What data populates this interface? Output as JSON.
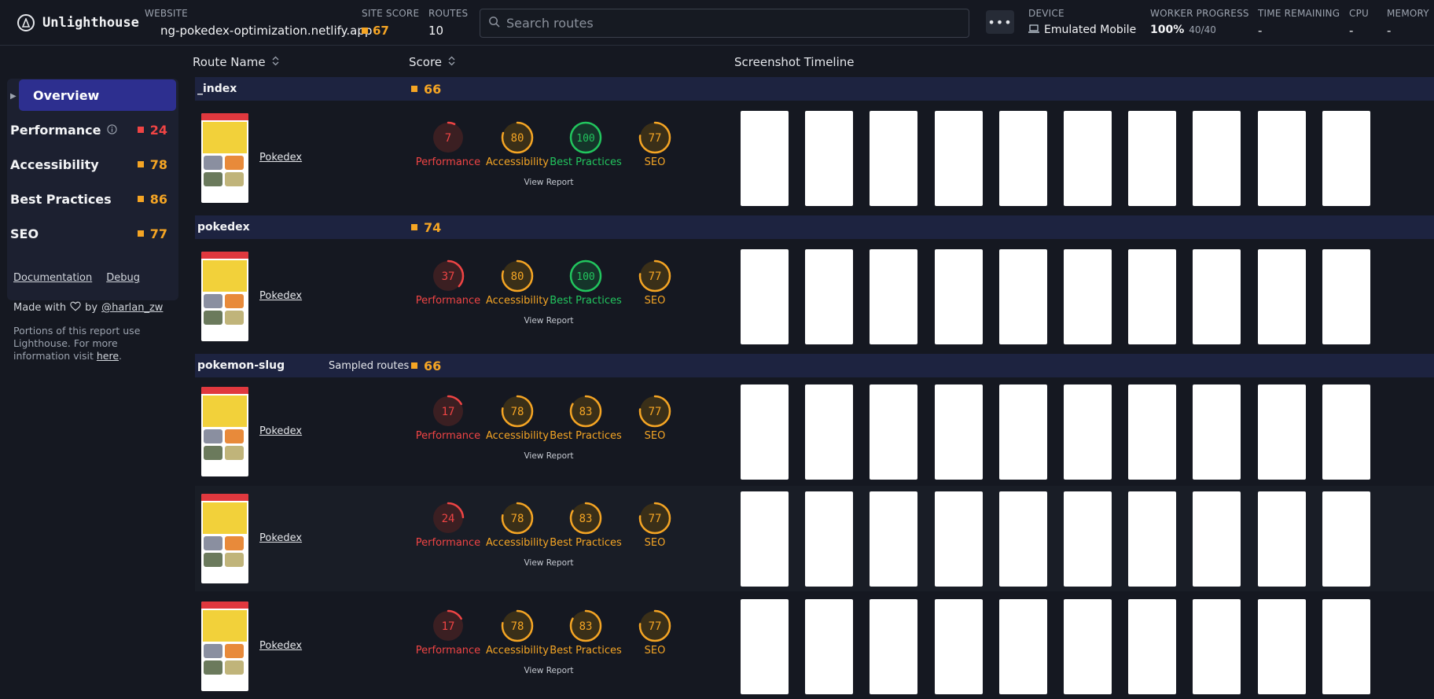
{
  "app": {
    "name": "Unlighthouse"
  },
  "header": {
    "website_label": "WEBSITE",
    "website_value": "ng-pokedex-optimization.netlify.app",
    "site_score_label": "SITE SCORE",
    "site_score_value": "67",
    "routes_label": "ROUTES",
    "routes_value": "10",
    "search_placeholder": "Search routes",
    "more_label": "•••",
    "device_label": "DEVICE",
    "device_value": "Emulated Mobile",
    "worker_label": "WORKER PROGRESS",
    "worker_value": "100%",
    "worker_count": "40/40",
    "time_label": "TIME REMAINING",
    "time_value": "-",
    "cpu_label": "CPU",
    "cpu_value": "-",
    "memory_label": "MEMORY",
    "memory_value": "-"
  },
  "sidebar": {
    "overview": "Overview",
    "items": [
      {
        "label": "Performance",
        "score": "24",
        "color": "#ef4444"
      },
      {
        "label": "Accessibility",
        "score": "78",
        "color": "#f5a524"
      },
      {
        "label": "Best Practices",
        "score": "86",
        "color": "#f5a524"
      },
      {
        "label": "SEO",
        "score": "77",
        "color": "#f5a524"
      }
    ],
    "documentation": "Documentation",
    "debug": "Debug",
    "made_with": "Made with",
    "by": "by",
    "author": "@harlan_zw",
    "portions": "Portions of this report use Lighthouse. For more information visit",
    "here": "here",
    "period": "."
  },
  "table": {
    "col_route": "Route Name",
    "col_score": "Score",
    "col_timeline": "Screenshot Timeline",
    "view_report": "View Report",
    "route_link": "Pokedex",
    "sampled": "Sampled routes",
    "groups": [
      {
        "name": "_index",
        "score": "66"
      },
      {
        "name": "pokedex",
        "score": "74"
      },
      {
        "name": "pokemon-slug",
        "score": "66"
      }
    ],
    "rows": [
      {
        "scores": [
          7,
          80,
          100,
          77
        ]
      },
      {
        "scores": [
          37,
          80,
          100,
          77
        ]
      },
      {
        "scores": [
          17,
          78,
          83,
          77
        ]
      },
      {
        "scores": [
          24,
          78,
          83,
          77
        ]
      },
      {
        "scores": [
          17,
          78,
          83,
          77
        ]
      }
    ],
    "gauge_labels": [
      "Performance",
      "Accessibility",
      "Best Practices",
      "SEO"
    ]
  },
  "colors": {
    "red": "#ef4444",
    "orange": "#f5a524",
    "green": "#22c55e",
    "accent": "#2d2f8f"
  }
}
